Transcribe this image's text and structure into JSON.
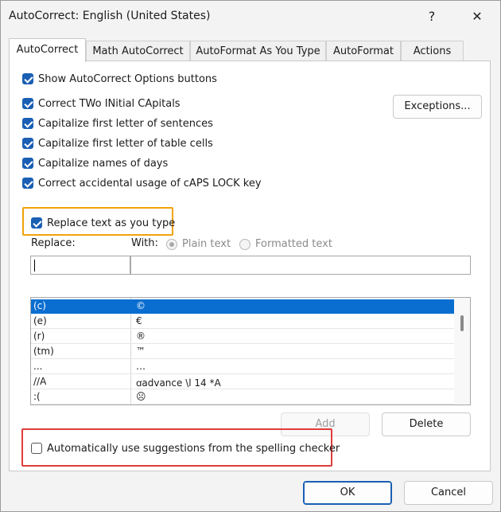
{
  "window": {
    "title": "AutoCorrect: English (United States)",
    "help_glyph": "?",
    "close_glyph": "✕"
  },
  "tabs": [
    {
      "label": "AutoCorrect",
      "active": true
    },
    {
      "label": "Math AutoCorrect",
      "active": false
    },
    {
      "label": "AutoFormat As You Type",
      "active": false
    },
    {
      "label": "AutoFormat",
      "active": false
    },
    {
      "label": "Actions",
      "active": false
    }
  ],
  "options": {
    "show_buttons": "Show AutoCorrect Options buttons",
    "two_initials": "Correct TWo INitial CApitals",
    "first_letter_sentences": "Capitalize first letter of sentences",
    "first_letter_table": "Capitalize first letter of table cells",
    "names_of_days": "Capitalize names of days",
    "caps_lock": "Correct accidental usage of cAPS LOCK key",
    "replace_text": "Replace text as you type",
    "spelling_suggestions": "Automatically use suggestions from the spelling checker"
  },
  "buttons": {
    "exceptions": "Exceptions...",
    "add": "Add",
    "delete": "Delete",
    "ok": "OK",
    "cancel": "Cancel"
  },
  "replace_section": {
    "replace_label": "Replace:",
    "with_label": "With:",
    "plain_text": "Plain text",
    "formatted_text": "Formatted text",
    "replace_value": "",
    "with_value": ""
  },
  "entries": [
    {
      "replace": "(c)",
      "with": "©"
    },
    {
      "replace": "(e)",
      "with": "€"
    },
    {
      "replace": "(r)",
      "with": "®"
    },
    {
      "replace": "(tm)",
      "with": "™"
    },
    {
      "replace": "...",
      "with": "…"
    },
    {
      "replace": "//A",
      "with": "ꭤadvance \\l 14 *A"
    },
    {
      "replace": ":(",
      "with": "☹"
    }
  ],
  "colors": {
    "accent": "#1a5fb4",
    "selection": "#0a6ed1",
    "highlight_orange": "#f0a30a",
    "highlight_red": "#e03c3c"
  }
}
